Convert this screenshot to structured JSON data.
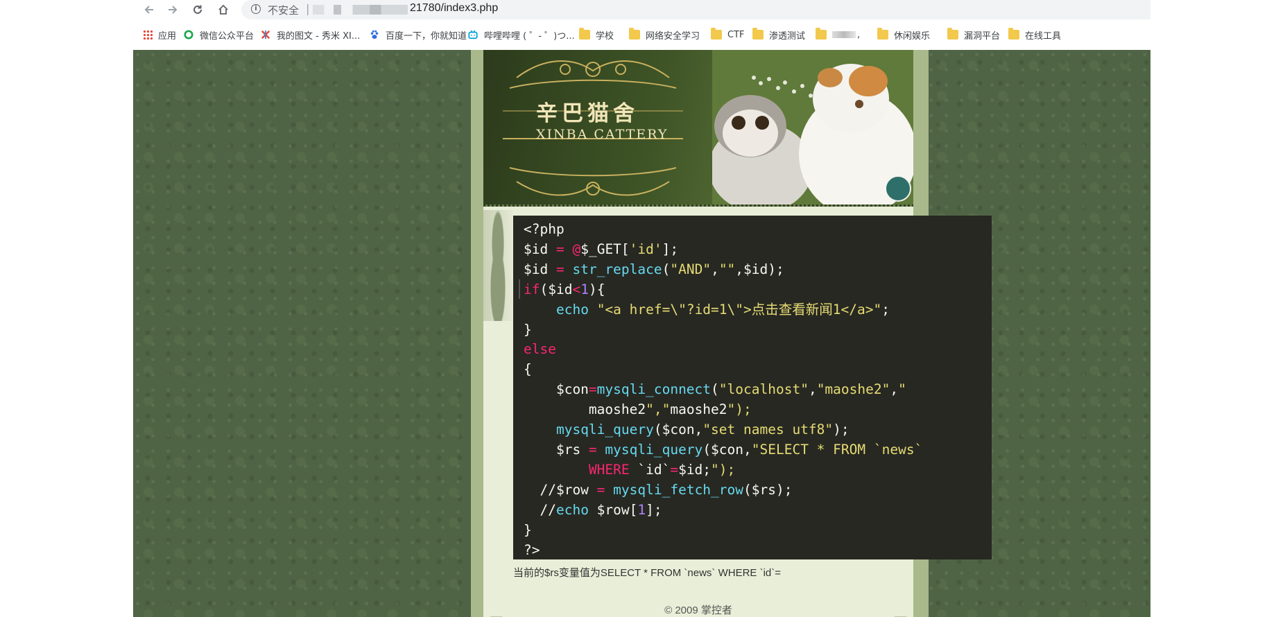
{
  "browser": {
    "security_label": "不安全",
    "url_separator": "|",
    "url_visible": "21780/index3.php",
    "bookmarks": [
      {
        "label": "应用",
        "icon": "apps-grid-icon"
      },
      {
        "label": "微信公众平台",
        "icon": "wechat-icon"
      },
      {
        "label": "我的图文 - 秀米 XI...",
        "icon": "xiumi-icon"
      },
      {
        "label": "百度一下，你就知道",
        "icon": "baidu-paw-icon"
      },
      {
        "label": "哔哩哔哩 ( ゜- ゜)つ...",
        "icon": "bilibili-icon"
      },
      {
        "label": "学校",
        "icon": "folder-icon"
      },
      {
        "label": "网络安全学习",
        "icon": "folder-icon"
      },
      {
        "label": "CTF",
        "icon": "folder-icon"
      },
      {
        "label": "渗透测试",
        "icon": "folder-icon"
      },
      {
        "label": ",",
        "icon": "folder-icon"
      },
      {
        "label": "休闲娱乐",
        "icon": "folder-icon"
      },
      {
        "label": "漏洞平台",
        "icon": "folder-icon"
      },
      {
        "label": "在线工具",
        "icon": "folder-icon"
      }
    ]
  },
  "site": {
    "logo_cn": "辛巴猫舍",
    "logo_en": "XINBA CATTERY",
    "code_lines": [
      "<?php",
      "$id = @$_GET['id'];",
      "$id = str_replace(\"AND\",\"\",$id);",
      "if($id<1){",
      "    echo \"<a href=\\\"?id=1\\\">点击查看新闻1</a>\";",
      "}",
      "else",
      "{",
      "    $con=mysqli_connect(\"localhost\",\"maoshe2\",\"",
      "        maoshe2\",\"maoshe2\");",
      "    mysqli_query($con,\"set names utf8\");",
      "    $rs = mysqli_query($con,\"SELECT * FROM `news`",
      "        WHERE `id`=$id;\");",
      "  //$row = mysqli_fetch_row($rs);",
      "  //echo $row[1];",
      "}",
      "?>"
    ],
    "result_text": "当前的$rs变量值为SELECT * FROM `news` WHERE `id`=",
    "footer": "© 2009 掌控者"
  },
  "colors": {
    "page_bg": "#4f6444",
    "code_bg": "#272822",
    "keyword": "#f92672",
    "function": "#66d9ef",
    "string": "#e6db74",
    "number": "#ae81ff"
  }
}
